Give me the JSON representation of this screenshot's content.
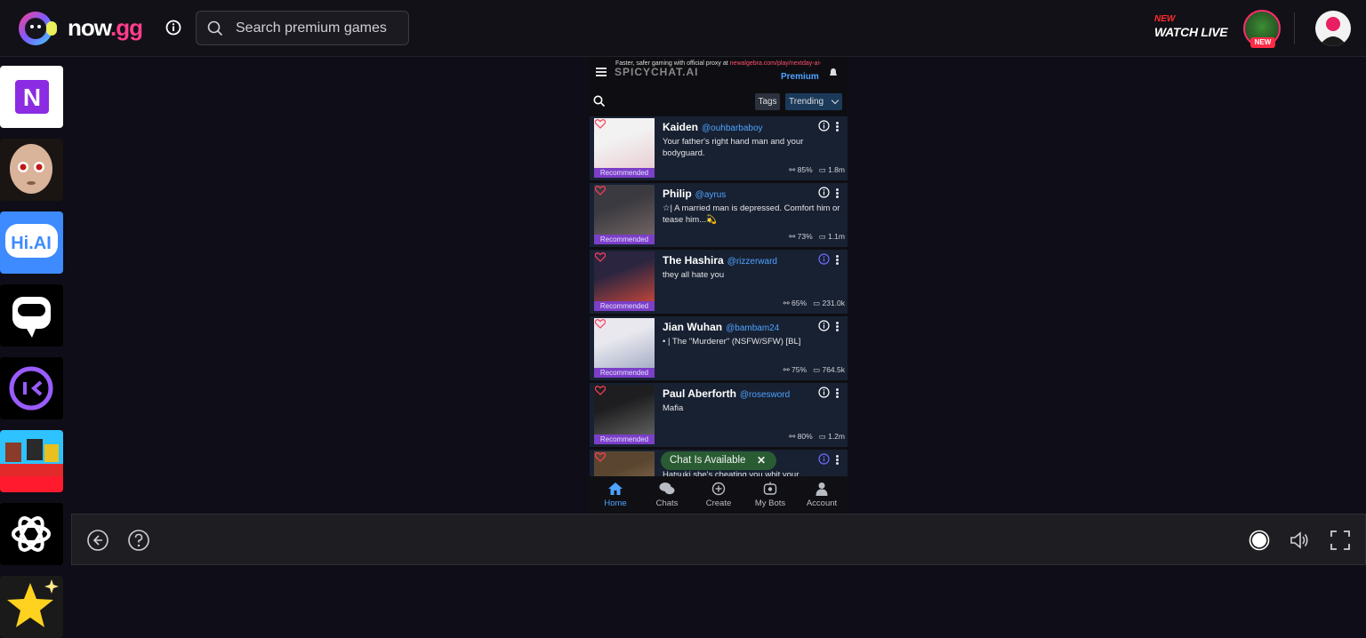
{
  "header": {
    "brand_main": "now",
    "brand_dot": ".gg",
    "search_placeholder": "Search premium games",
    "watch_new": "NEW",
    "watch_live": "WATCH LIVE",
    "live_badge": "NEW"
  },
  "sidebar": {
    "apps": [
      {
        "name": "N",
        "bg": "#ffffff",
        "fg": "#8b2be2"
      },
      {
        "name": "bald-doll-game-icon",
        "bg": "#1a1512"
      },
      {
        "name": "Hi.AI",
        "bg": "#3d8bff"
      },
      {
        "name": "chat-bubble-app-icon",
        "bg": "#000000"
      },
      {
        "name": "purple-chat-app-icon",
        "bg": "#000000"
      },
      {
        "name": "blocky-game-icon",
        "bg": "#e22a2a"
      },
      {
        "name": "openai-icon",
        "bg": "#000000"
      },
      {
        "name": "star-app-icon",
        "bg": "#1a1a1a"
      }
    ]
  },
  "game": {
    "proxy_text": "Faster, safer gaming with official proxy at ",
    "proxy_link": "newalgebra.com/play/nextday-ai-",
    "logo_text": "SPICYCHAT.AI",
    "premium": "Premium",
    "tags": "Tags",
    "trending": "Trending",
    "cards": [
      {
        "name": "Kaiden",
        "handle": "@ouhbarbaboy",
        "desc": "Your father's right hand man and your bodyguard.",
        "rating": "85%",
        "chats": "1.8m",
        "badge": "Recommended",
        "info_color": "#ffffff"
      },
      {
        "name": "Philip",
        "handle": "@ayrus",
        "desc": "☆| A married man is depressed. Comfort him or tease him...💫",
        "rating": "73%",
        "chats": "1.1m",
        "badge": "Recommended",
        "info_color": "#ffffff"
      },
      {
        "name": "The Hashira",
        "handle": "@rizzerward",
        "desc": "they all hate you",
        "rating": "65%",
        "chats": "231.0k",
        "badge": "Recommended",
        "info_color": "#6b6bff"
      },
      {
        "name": "Jian Wuhan",
        "handle": "@bambam24",
        "desc": "• | The \"Murderer\" (NSFW/SFW) [BL]",
        "rating": "75%",
        "chats": "764.5k",
        "badge": "Recommended",
        "info_color": "#ffffff"
      },
      {
        "name": "Paul Aberforth",
        "handle": "@rosesword",
        "desc": "Mafia",
        "rating": "80%",
        "chats": "1.2m",
        "badge": "Recommended",
        "info_color": "#ffffff"
      },
      {
        "name": "",
        "handle": "",
        "desc": "Hatsuki she's cheating you whit your",
        "rating": "",
        "chats": "",
        "badge": "",
        "info_color": "#6b6bff"
      }
    ],
    "toast": "Chat Is Available",
    "nav": [
      {
        "label": "Home",
        "icon": "home-icon"
      },
      {
        "label": "Chats",
        "icon": "chats-icon"
      },
      {
        "label": "Create",
        "icon": "create-icon"
      },
      {
        "label": "My Bots",
        "icon": "my-bots-icon"
      },
      {
        "label": "Account",
        "icon": "account-icon"
      }
    ]
  },
  "colors": {
    "accent": "#4ea3ff",
    "brand_pink": "#ff3d8b",
    "recommended": "#7b3fc8",
    "card_bg": "#182132"
  }
}
